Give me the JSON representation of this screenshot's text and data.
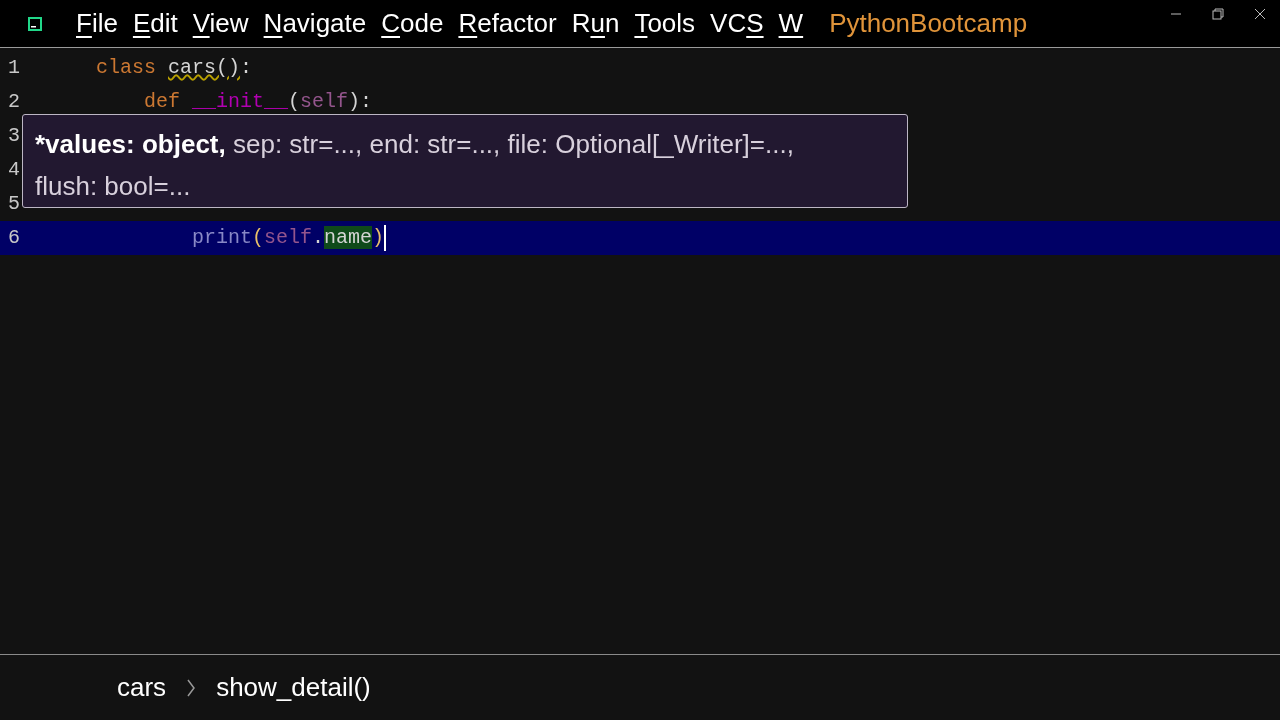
{
  "menu": [
    {
      "key": "F",
      "post": "ile"
    },
    {
      "key": "E",
      "post": "dit"
    },
    {
      "key": "V",
      "post": "iew"
    },
    {
      "key": "N",
      "post": "avigate"
    },
    {
      "key": "C",
      "post": "ode"
    },
    {
      "key": "R",
      "post": "efactor"
    },
    {
      "pre": "R",
      "key": "u",
      "post": "n"
    },
    {
      "key": "T",
      "post": "ools"
    },
    {
      "pre": "VC",
      "key": "S"
    },
    {
      "key": "W"
    }
  ],
  "project": "PythonBootcamp",
  "lines": [
    {
      "number": "1",
      "current": false,
      "tokens": [
        {
          "kind": "keyword",
          "text": "class "
        },
        {
          "kind": "warn",
          "text": "cars()"
        },
        {
          "kind": "plain",
          "text": ":"
        }
      ],
      "children": [
        {
          "number": "2",
          "current": false,
          "tokens": [
            {
              "kind": "keyword",
              "text": "def "
            },
            {
              "kind": "magic",
              "text": "__init__"
            },
            {
              "kind": "plain",
              "text": "("
            },
            {
              "kind": "self",
              "text": "self"
            },
            {
              "kind": "plain",
              "text": "):"
            }
          ],
          "children": [
            {
              "number": "3",
              "current": false
            },
            {
              "number": "4",
              "current": false
            }
          ]
        },
        {
          "number": "5",
          "current": false,
          "children": [
            {
              "number": "6",
              "current": true,
              "tokens": [
                {
                  "kind": "builtin",
                  "text": "print"
                },
                {
                  "kind": "paren",
                  "text": "("
                },
                {
                  "kind": "self",
                  "text": "self"
                },
                {
                  "kind": "plain",
                  "text": "."
                },
                {
                  "kind": "match",
                  "text": "name"
                },
                {
                  "kind": "paren",
                  "text": ")"
                }
              ]
            }
          ]
        }
      ]
    }
  ],
  "tooltip": {
    "bold": "*values: object,",
    "rest": " sep: str=..., end: str=..., file: Optional[_Writer]=...,",
    "line2": "flush: bool=..."
  },
  "breadcrumbs": [
    "cars",
    "show_detail()"
  ]
}
